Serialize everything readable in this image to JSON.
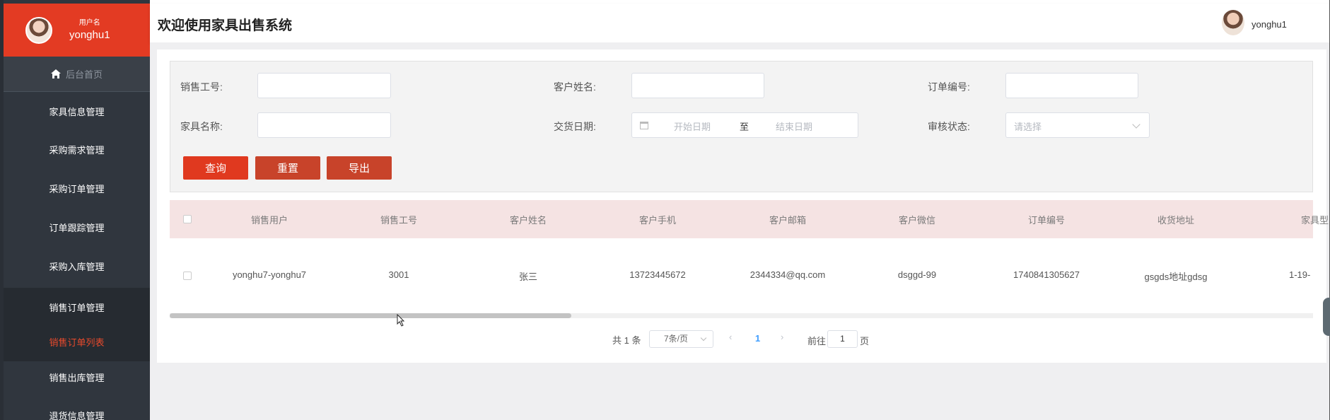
{
  "sidebar": {
    "user_caption": "用户名",
    "user_name": "yonghu1",
    "home_label": "后台首页",
    "items": [
      {
        "label": "家具信息管理"
      },
      {
        "label": "采购需求管理"
      },
      {
        "label": "采购订单管理"
      },
      {
        "label": "订单跟踪管理"
      },
      {
        "label": "采购入库管理"
      },
      {
        "label": "销售订单管理"
      },
      {
        "label": "销售订单列表"
      },
      {
        "label": "销售出库管理"
      },
      {
        "label": "退货信息管理"
      }
    ],
    "active_item": "销售订单列表",
    "accent_color": "#e33b23"
  },
  "header": {
    "title": "欢迎使用家具出售系统",
    "user_name": "yonghu1"
  },
  "search": {
    "sales_no_label": "销售工号:",
    "customer_name_label": "客户姓名:",
    "order_no_label": "订单编号:",
    "furniture_name_label": "家具名称:",
    "delivery_date_label": "交货日期:",
    "audit_status_label": "审核状态:",
    "start_date_placeholder": "开始日期",
    "date_separator": "至",
    "end_date_placeholder": "结束日期",
    "audit_status_placeholder": "请选择",
    "query_button": "查询",
    "reset_button": "重置",
    "export_button": "导出"
  },
  "table": {
    "columns": [
      "销售用户",
      "销售工号",
      "客户姓名",
      "客户手机",
      "客户邮箱",
      "客户微信",
      "订单编号",
      "收货地址",
      "家具型"
    ],
    "rows": [
      [
        "yonghu7-yonghu7",
        "3001",
        "张三",
        "13723445672",
        "2344334@qq.com",
        "dsggd-99",
        "1740841305627",
        "gsgds地址gdsg",
        "1-19-"
      ]
    ]
  },
  "pagination": {
    "total_text": "共 1 条",
    "page_size": "7条/页",
    "prev": "‹",
    "current_page": "1",
    "next": "›",
    "goto_label": "前往",
    "goto_value": "1",
    "page_suffix": "页"
  }
}
